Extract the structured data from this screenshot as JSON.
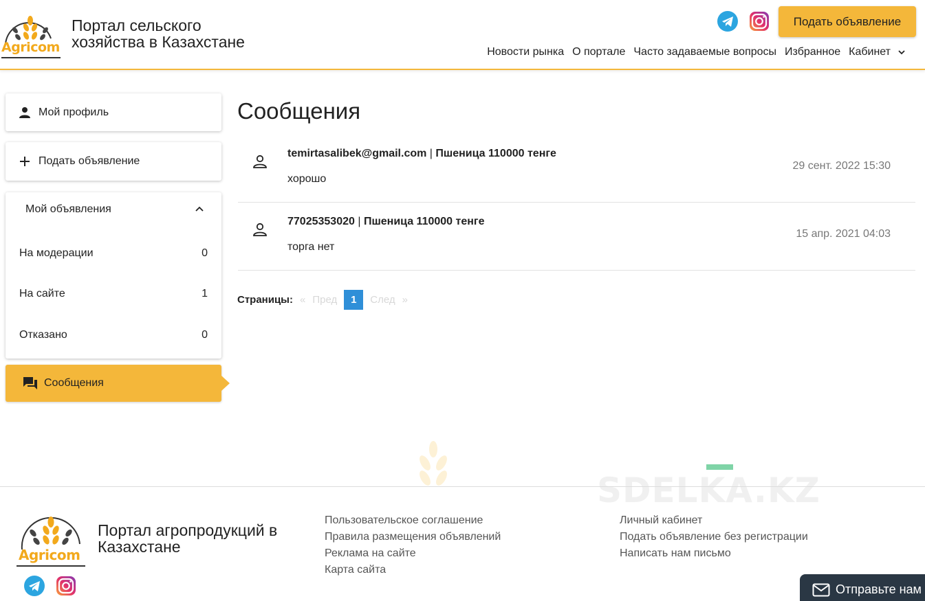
{
  "header": {
    "logo_text": "Agricom",
    "site_title": "Портал сельского хозяйства в Казахстане",
    "post_button": "Подать объявление",
    "nav": [
      "Новости рынка",
      "О портале",
      "Часто задаваемые вопросы",
      "Избранное",
      "Кабинет"
    ]
  },
  "sidebar": {
    "profile": "Мой профиль",
    "post_ad": "Подать объявление",
    "my_ads": {
      "title": "Мой объявления",
      "rows": [
        {
          "label": "На модерации",
          "count": "0"
        },
        {
          "label": "На сайте",
          "count": "1"
        },
        {
          "label": "Отказано",
          "count": "0"
        }
      ]
    },
    "messages": "Сообщения"
  },
  "main": {
    "title": "Сообщения",
    "messages": [
      {
        "sender": "temirtasalibek@gmail.com",
        "separator": " | ",
        "subject": "Пшеница 110000 тенге",
        "text": "хорошо",
        "date": "29 сент. 2022 15:30"
      },
      {
        "sender": "77025353020",
        "separator": " | ",
        "subject": "Пшеница 110000 тенге",
        "text": "торга нет",
        "date": "15 апр. 2021 04:03"
      }
    ],
    "pager": {
      "label": "Страницы:",
      "first": "«",
      "prev": "Пред",
      "current": "1",
      "next": "След",
      "last": "»"
    }
  },
  "footer": {
    "logo_text": "Agricom",
    "title": "Портал агропродукций в Казахстане",
    "watermark": "SDELKA.KZ",
    "col1": [
      "Пользовательское соглашение",
      "Правила размещения объявлений",
      "Реклама на сайте",
      "Карта сайта"
    ],
    "col2": [
      "Личный кабинет",
      "Подать объявление без регистрации",
      "Написать нам письмо"
    ],
    "chat": "Отправьте нам"
  },
  "colors": {
    "accent": "#f4b73a",
    "pager_active": "#2f8fd8",
    "chat_bg": "#2a3744"
  }
}
